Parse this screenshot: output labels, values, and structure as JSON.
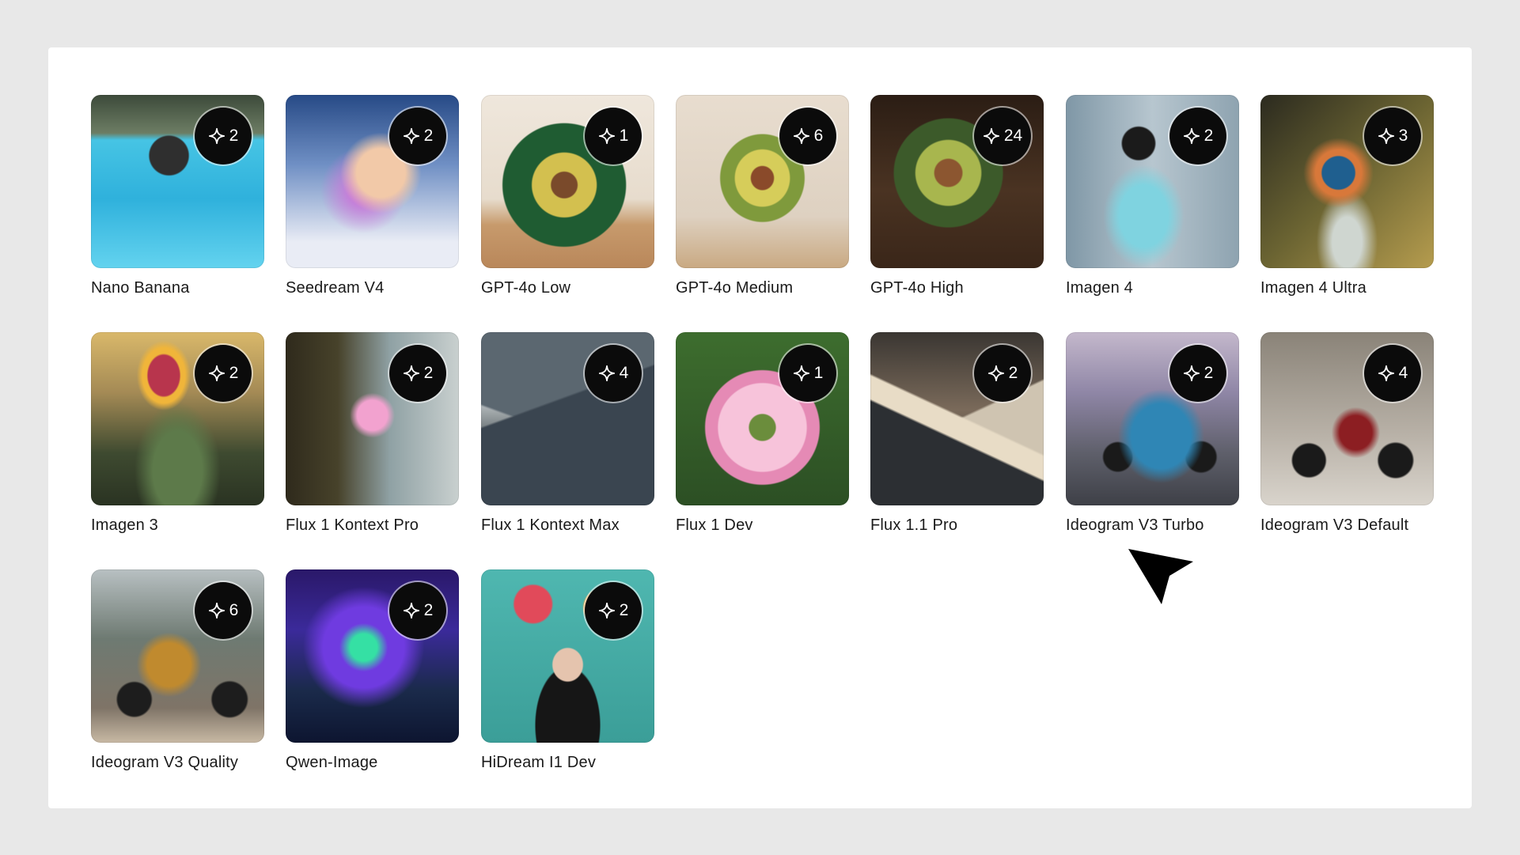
{
  "models": [
    {
      "name": "Nano Banana",
      "count": "2",
      "bg": "radial-gradient(circle at 45% 35%, #2f2f2f 0 13%, transparent 14%), linear-gradient(180deg, #3d4a3a 0%, #6c7d64 22%, #46c4e4 26%, #2fb1dc 60%, #63d3ef 100%)"
    },
    {
      "name": "Seedream V4",
      "count": "2",
      "bg": "radial-gradient(circle at 55% 45%, #f2c9a8 0 18%, transparent 30%), radial-gradient(circle at 45% 55%, #c77bd9 0 10%, transparent 32%), linear-gradient(180deg, #274a86 0%, #6f8fc4 40%, #e9ecf5 85%)"
    },
    {
      "name": "GPT-4o Low",
      "count": "1",
      "bg": "radial-gradient(ellipse at 48% 52%, #7a4a2b 0 10%, #d3c04f 11% 25%, #1f5c32 26% 48%, transparent 49%), linear-gradient(180deg, #efe7dc 0%, #e7dccd 60%, #c79a6c 75%, #b9875a 100%)"
    },
    {
      "name": "GPT-4o Medium",
      "count": "6",
      "bg": "radial-gradient(ellipse at 50% 48%, #8a4a2a 0 9%, #d6cd5a 10% 22%, #7f9a3c 23% 34%, transparent 35%), linear-gradient(180deg, #e8ddcf 0%, #ded1c1 70%, #c9a982 100%)"
    },
    {
      "name": "GPT-4o High",
      "count": "24",
      "bg": "radial-gradient(ellipse at 45% 45%, #8c5630 0 10%, #a8b64e 11% 24%, #3c5a2a 25% 40%, transparent 41%), linear-gradient(180deg, #2b1d14 0%, #4a3322 55%, #3a2619 100%)"
    },
    {
      "name": "Imagen 4",
      "count": "2",
      "bg": "radial-gradient(ellipse at 45% 70%, #7fd3e0 0 18%, transparent 30%), radial-gradient(circle at 42% 28%, #1b1b1b 0 10%, transparent 11%), linear-gradient(90deg, #7f97a6 0%, #b7c6cf 50%, #8ea3b0 100%)"
    },
    {
      "name": "Imagen 4 Ultra",
      "count": "3",
      "bg": "radial-gradient(ellipse at 45% 45%, #1f5f8f 0 12%, #d8783a 13% 17%, transparent 26%), radial-gradient(ellipse at 50% 85%, #cfd6d0 0 12%, transparent 25%), linear-gradient(135deg, #2b2a1f 0%, #6b6432 50%, #b59c4e 100%)"
    },
    {
      "name": "Imagen 3",
      "count": "2",
      "bg": "radial-gradient(ellipse at 42% 25%, #b8354d 0 11%, #f0b53a 12% 15%, transparent 19%), radial-gradient(ellipse at 50% 80%, #5d7a4a 0 20%, transparent 35%), linear-gradient(180deg, #d9b86a 0%, #a48a55 35%, #3e4a30 70%, #2a3322 100%)"
    },
    {
      "name": "Flux 1 Kontext Pro",
      "count": "2",
      "bg": "radial-gradient(circle at 50% 48%, #f2a2cf 0 12%, transparent 18%), linear-gradient(90deg, #2f2a1c 0%, #47422a 30%, #8fa1a4 60%, #c9d0cf 100%)"
    },
    {
      "name": "Flux 1 Kontext Max",
      "count": "4",
      "bg": "linear-gradient(160deg, transparent 40%, #3a4550 41%), linear-gradient(20deg, transparent 42%, #5b6770 43%), linear-gradient(180deg, #cfd6da 0%, #e8ecee 30%, #1f2a2e 75%, #0f171b 100%)"
    },
    {
      "name": "Flux 1 Dev",
      "count": "1",
      "bg": "radial-gradient(circle at 50% 55%, #6b8d3c 0 10%, #f7c3da 11% 34%, #e58ab5 35% 44%, transparent 45%), linear-gradient(180deg, #3d6d2e 0%, #2c4f24 100%)"
    },
    {
      "name": "Flux 1.1 Pro",
      "count": "2",
      "bg": "linear-gradient(205deg, transparent 48%, #e8dcc6 49% 58%, #2c2f33 59%), linear-gradient(155deg, transparent 50%, #cfc4b1 51%), linear-gradient(180deg, #3a3632 0%, #7a6a5a 45%, #1f2124 100%)"
    },
    {
      "name": "Ideogram V3 Turbo",
      "count": "2",
      "bg": "radial-gradient(ellipse at 55% 60%, #2f86b5 0 22%, transparent 32%), radial-gradient(circle at 30% 72%, #1a1a1a 0 8%, transparent 9%), radial-gradient(circle at 78% 72%, #1a1a1a 0 8%, transparent 9%), linear-gradient(180deg, #c4b8cc 0%, #8f86a6 35%, #5e5f6a 70%, #3e4047 100%)"
    },
    {
      "name": "Ideogram V3 Default",
      "count": "4",
      "bg": "radial-gradient(ellipse at 55% 58%, #8c1e22 0 12%, transparent 18%), radial-gradient(circle at 28% 74%, #1a1a1a 0 9%, transparent 10%), radial-gradient(circle at 78% 74%, #1a1a1a 0 9%, transparent 10%), linear-gradient(180deg, #8a8378 0%, #b9b2a8 60%, #d9d4cc 100%)"
    },
    {
      "name": "Ideogram V3 Quality",
      "count": "6",
      "bg": "radial-gradient(ellipse at 45% 55%, #c08a2e 0 16%, transparent 24%), radial-gradient(circle at 25% 75%, #1d1d1d 0 9%, transparent 10%), radial-gradient(circle at 80% 75%, #1d1d1d 0 9%, transparent 10%), linear-gradient(180deg, #b8c0c2 0%, #6e7a72 40%, #7f7467 80%, #c8b9a4 100%)"
    },
    {
      "name": "Qwen-Image",
      "count": "2",
      "bg": "radial-gradient(ellipse at 45% 45%, #35e0a4 0 10%, #6f3be0 18% 30%, transparent 45%), linear-gradient(180deg, #2a1869 0%, #3b2a9a 35%, #1a2a4a 70%, #0d1530 100%)"
    },
    {
      "name": "HiDream I1 Dev",
      "count": "2",
      "bg": "radial-gradient(ellipse at 50% 55%, #e5c4ae 0 12%, transparent 13%), radial-gradient(ellipse at 50% 90%, #161616 0 26%, transparent 27%), radial-gradient(circle at 30% 20%, #e14a5a 0 10%, transparent 11%), radial-gradient(circle at 70% 22%, #f2a33a 0 10%, transparent 11%), linear-gradient(180deg, #4fb7b0 0%, #3b9e98 100%)"
    }
  ]
}
